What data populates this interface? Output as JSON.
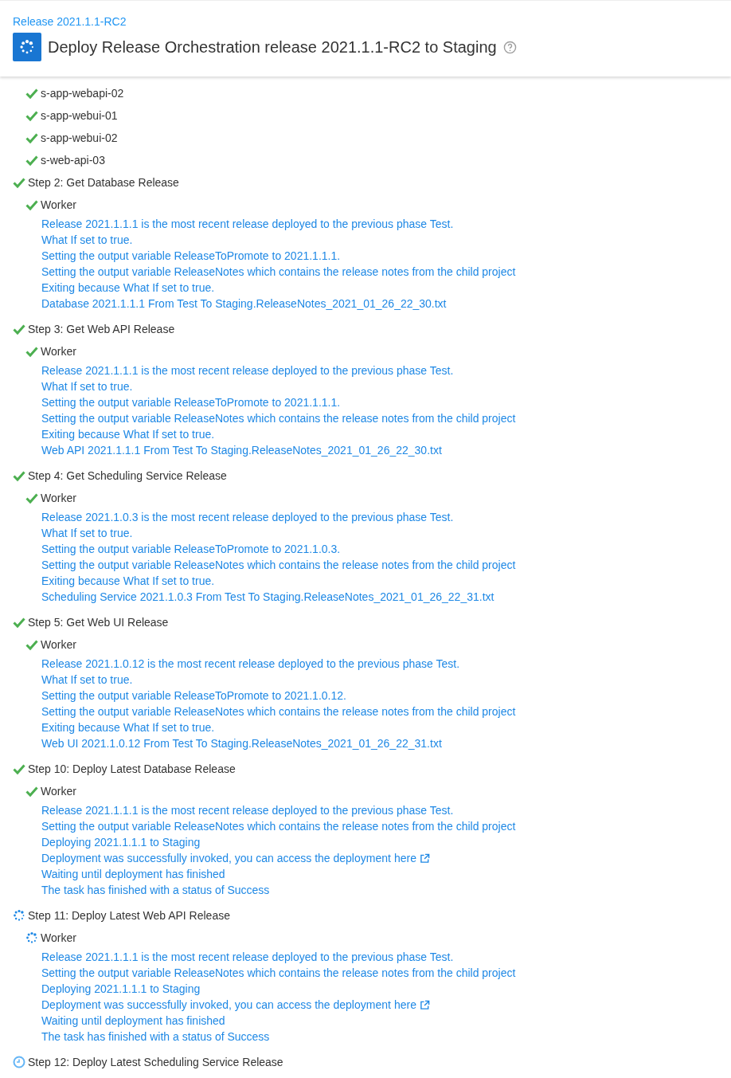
{
  "header": {
    "breadcrumb": "Release 2021.1.1-RC2",
    "title": "Deploy Release Orchestration release 2021.1.1-RC2 to Staging"
  },
  "servers": [
    {
      "name": "s-app-webapi-02",
      "kind": "success"
    },
    {
      "name": "s-app-webui-01",
      "kind": "success"
    },
    {
      "name": "s-app-webui-02",
      "kind": "success"
    },
    {
      "name": "s-web-api-03",
      "kind": "success"
    }
  ],
  "steps": [
    {
      "name": "Step 2: Get Database Release",
      "kind": "success",
      "children": [
        {
          "name": "Worker",
          "kind": "success",
          "log": [
            {
              "text": "Release 2021.1.1.1 is the most recent release deployed to the previous phase Test."
            },
            {
              "text": "What If set to true."
            },
            {
              "text": "Setting the output variable ReleaseToPromote to 2021.1.1.1."
            },
            {
              "text": "Setting the output variable ReleaseNotes which contains the release notes from the child project"
            },
            {
              "text": "Exiting because What If set to true."
            },
            {
              "text": "Database 2021.1.1.1 From Test To Staging.ReleaseNotes_2021_01_26_22_30.txt"
            }
          ]
        }
      ]
    },
    {
      "name": "Step 3: Get Web API Release",
      "kind": "success",
      "children": [
        {
          "name": "Worker",
          "kind": "success",
          "log": [
            {
              "text": "Release 2021.1.1.1 is the most recent release deployed to the previous phase Test."
            },
            {
              "text": "What If set to true."
            },
            {
              "text": "Setting the output variable ReleaseToPromote to 2021.1.1.1."
            },
            {
              "text": "Setting the output variable ReleaseNotes which contains the release notes from the child project"
            },
            {
              "text": "Exiting because What If set to true."
            },
            {
              "text": "Web API 2021.1.1.1 From Test To Staging.ReleaseNotes_2021_01_26_22_30.txt"
            }
          ]
        }
      ]
    },
    {
      "name": "Step 4: Get Scheduling Service Release",
      "kind": "success",
      "children": [
        {
          "name": "Worker",
          "kind": "success",
          "log": [
            {
              "text": "Release 2021.1.0.3 is the most recent release deployed to the previous phase Test."
            },
            {
              "text": "What If set to true."
            },
            {
              "text": "Setting the output variable ReleaseToPromote to 2021.1.0.3."
            },
            {
              "text": "Setting the output variable ReleaseNotes which contains the release notes from the child project"
            },
            {
              "text": "Exiting because What If set to true."
            },
            {
              "text": "Scheduling Service 2021.1.0.3 From Test To Staging.ReleaseNotes_2021_01_26_22_31.txt"
            }
          ]
        }
      ]
    },
    {
      "name": "Step 5: Get Web UI Release",
      "kind": "success",
      "children": [
        {
          "name": "Worker",
          "kind": "success",
          "log": [
            {
              "text": "Release 2021.1.0.12 is the most recent release deployed to the previous phase Test."
            },
            {
              "text": "What If set to true."
            },
            {
              "text": "Setting the output variable ReleaseToPromote to 2021.1.0.12."
            },
            {
              "text": "Setting the output variable ReleaseNotes which contains the release notes from the child project"
            },
            {
              "text": "Exiting because What If set to true."
            },
            {
              "text": "Web UI 2021.1.0.12 From Test To Staging.ReleaseNotes_2021_01_26_22_31.txt"
            }
          ]
        }
      ]
    },
    {
      "name": "Step 10: Deploy Latest Database Release",
      "kind": "success",
      "children": [
        {
          "name": "Worker",
          "kind": "success",
          "log": [
            {
              "text": "Release 2021.1.1.1 is the most recent release deployed to the previous phase Test."
            },
            {
              "text": "Setting the output variable ReleaseNotes which contains the release notes from the child project"
            },
            {
              "text": "Deploying 2021.1.1.1 to Staging"
            },
            {
              "text": "Deployment was successfully invoked, you can access the deployment",
              "link": "here"
            },
            {
              "text": "Waiting until deployment has finished"
            },
            {
              "text": "The task has finished with a status of Success"
            }
          ]
        }
      ]
    },
    {
      "name": "Step 11: Deploy Latest Web API Release",
      "kind": "running",
      "children": [
        {
          "name": "Worker",
          "kind": "running",
          "log": [
            {
              "text": "Release 2021.1.1.1 is the most recent release deployed to the previous phase Test."
            },
            {
              "text": "Setting the output variable ReleaseNotes which contains the release notes from the child project"
            },
            {
              "text": "Deploying 2021.1.1.1 to Staging"
            },
            {
              "text": "Deployment was successfully invoked, you can access the deployment",
              "link": "here"
            },
            {
              "text": "Waiting until deployment has finished"
            },
            {
              "text": "The task has finished with a status of Success"
            }
          ]
        }
      ]
    },
    {
      "name": "Step 12: Deploy Latest Scheduling Service Release",
      "kind": "pending"
    }
  ]
}
